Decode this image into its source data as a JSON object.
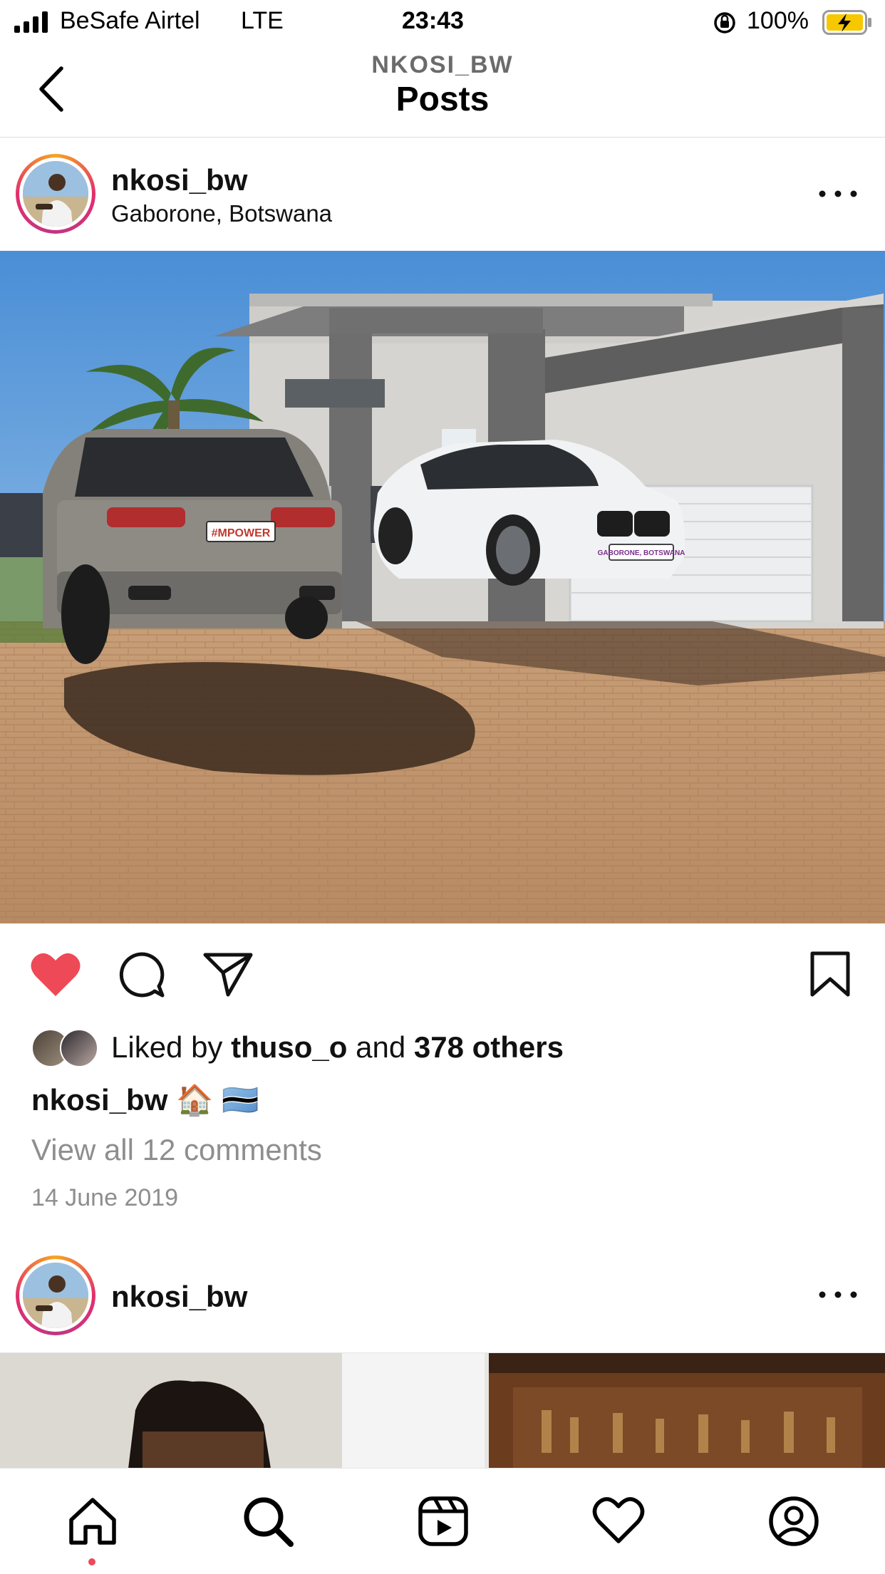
{
  "status_bar": {
    "carrier": "BeSafe Airtel",
    "network": "LTE",
    "time": "23:43",
    "battery": "100%"
  },
  "nav": {
    "subtitle": "NKOSI_BW",
    "title": "Posts"
  },
  "post1": {
    "username": "nkosi_bw",
    "location": "Gaborone, Botswana",
    "photo_plate_rear": "#MPOWER",
    "photo_plate_front": "GABORONE, BOTSWANA",
    "liked": true,
    "likes": {
      "prefix": "Liked by",
      "user": "thuso_o",
      "middle": "and",
      "others": "378 others"
    },
    "caption": {
      "username": "nkosi_bw",
      "emoji_house": "🏠",
      "emoji_flag": "🇧🇼"
    },
    "comments_link": "View all 12 comments",
    "date": "14 June 2019"
  },
  "post2": {
    "username": "nkosi_bw"
  },
  "colors": {
    "like_red": "#ed4956",
    "muted": "#8e8e8e",
    "notification_dot": "#ed4956"
  },
  "icons": {
    "back": "chevron-left-icon",
    "more": "more-horizontal-icon",
    "like": "heart-filled-icon",
    "comment": "comment-bubble-icon",
    "share": "paper-plane-icon",
    "save": "bookmark-icon",
    "tabs": [
      "home-icon",
      "search-icon",
      "reels-icon",
      "heart-icon",
      "profile-icon"
    ]
  }
}
